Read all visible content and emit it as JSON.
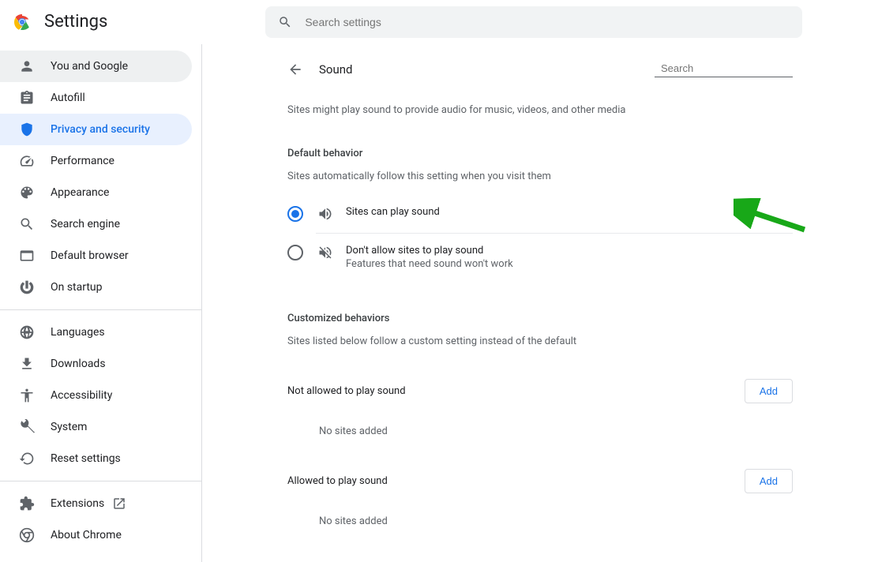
{
  "header": {
    "title": "Settings",
    "search_placeholder": "Search settings"
  },
  "sidebar": {
    "items": [
      {
        "id": "you-google",
        "label": "You and Google",
        "icon": "person"
      },
      {
        "id": "autofill",
        "label": "Autofill",
        "icon": "assignment"
      },
      {
        "id": "privacy",
        "label": "Privacy and security",
        "icon": "shield",
        "active": true
      },
      {
        "id": "performance",
        "label": "Performance",
        "icon": "speed"
      },
      {
        "id": "appearance",
        "label": "Appearance",
        "icon": "palette"
      },
      {
        "id": "search-engine",
        "label": "Search engine",
        "icon": "search"
      },
      {
        "id": "default-browser",
        "label": "Default browser",
        "icon": "browser"
      },
      {
        "id": "on-startup",
        "label": "On startup",
        "icon": "power"
      }
    ],
    "advanced": [
      {
        "id": "languages",
        "label": "Languages",
        "icon": "globe"
      },
      {
        "id": "downloads",
        "label": "Downloads",
        "icon": "download"
      },
      {
        "id": "accessibility",
        "label": "Accessibility",
        "icon": "accessibility"
      },
      {
        "id": "system",
        "label": "System",
        "icon": "build"
      },
      {
        "id": "reset",
        "label": "Reset settings",
        "icon": "restore"
      }
    ],
    "footer": [
      {
        "id": "extensions",
        "label": "Extensions",
        "icon": "extension",
        "external": true
      },
      {
        "id": "about",
        "label": "About Chrome",
        "icon": "chrome"
      }
    ]
  },
  "panel": {
    "title": "Sound",
    "search_placeholder": "Search",
    "description": "Sites might play sound to provide audio for music, videos, and other media",
    "default_behavior_title": "Default behavior",
    "default_behavior_sub": "Sites automatically follow this setting when you visit them",
    "options": [
      {
        "id": "allow",
        "label": "Sites can play sound",
        "sublabel": "",
        "selected": true,
        "icon": "volume-up"
      },
      {
        "id": "block",
        "label": "Don't allow sites to play sound",
        "sublabel": "Features that need sound won't work",
        "selected": false,
        "icon": "volume-off"
      }
    ],
    "customized_title": "Customized behaviors",
    "customized_sub": "Sites listed below follow a custom setting instead of the default",
    "not_allowed_label": "Not allowed to play sound",
    "allowed_label": "Allowed to play sound",
    "add_button": "Add",
    "no_sites_text": "No sites added"
  }
}
